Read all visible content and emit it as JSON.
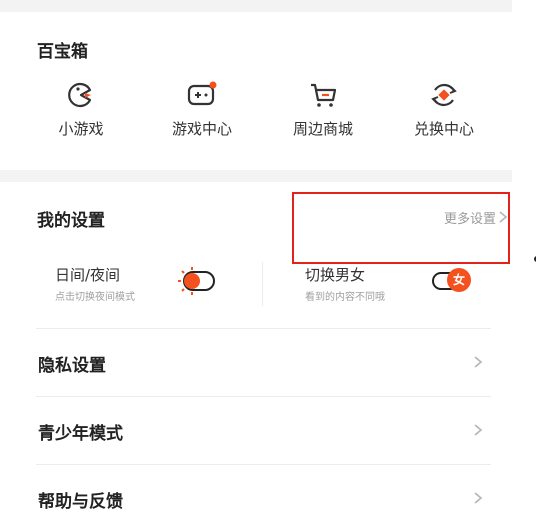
{
  "toolbox": {
    "title": "百宝箱",
    "items": [
      {
        "label": "小游戏",
        "icon": "pacman-icon"
      },
      {
        "label": "游戏中心",
        "icon": "gamepad-icon"
      },
      {
        "label": "周边商城",
        "icon": "shopping-cart-icon"
      },
      {
        "label": "兑换中心",
        "icon": "exchange-icon"
      }
    ]
  },
  "settings": {
    "title": "我的设置",
    "more_label": "更多设置",
    "day_night": {
      "title": "日间/夜间",
      "subtitle": "点击切换夜间模式"
    },
    "gender": {
      "title": "切换男女",
      "subtitle": "看到的内容不同哦",
      "badge": "女"
    },
    "rows": [
      {
        "label": "隐私设置"
      },
      {
        "label": "青少年模式"
      },
      {
        "label": "帮助与反馈"
      }
    ]
  },
  "colors": {
    "accent": "#f4511e",
    "highlight_box": "#e2231a",
    "text": "#222222"
  }
}
